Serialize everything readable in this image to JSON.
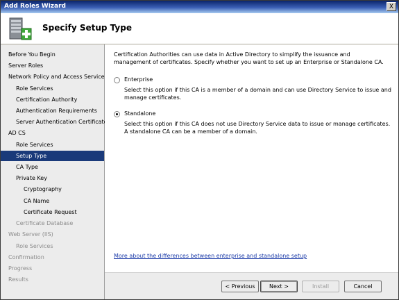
{
  "window": {
    "title": "Add Roles Wizard",
    "close_glyph": "X"
  },
  "header": {
    "title": "Specify Setup Type",
    "icon": "server-roles-add-icon"
  },
  "sidebar": {
    "items": [
      {
        "label": "Before You Begin",
        "level": 0,
        "state": "normal"
      },
      {
        "label": "Server Roles",
        "level": 0,
        "state": "normal"
      },
      {
        "label": "Network Policy and Access Services",
        "level": 0,
        "state": "normal"
      },
      {
        "label": "Role Services",
        "level": 1,
        "state": "normal"
      },
      {
        "label": "Certification Authority",
        "level": 1,
        "state": "normal"
      },
      {
        "label": "Authentication Requirements",
        "level": 1,
        "state": "normal"
      },
      {
        "label": "Server Authentication Certificate",
        "level": 1,
        "state": "normal"
      },
      {
        "label": "AD CS",
        "level": 0,
        "state": "normal"
      },
      {
        "label": "Role Services",
        "level": 1,
        "state": "normal"
      },
      {
        "label": "Setup Type",
        "level": 1,
        "state": "selected"
      },
      {
        "label": "CA Type",
        "level": 1,
        "state": "normal"
      },
      {
        "label": "Private Key",
        "level": 1,
        "state": "normal"
      },
      {
        "label": "Cryptography",
        "level": 2,
        "state": "normal"
      },
      {
        "label": "CA Name",
        "level": 2,
        "state": "normal"
      },
      {
        "label": "Certificate Request",
        "level": 2,
        "state": "normal"
      },
      {
        "label": "Certificate Database",
        "level": 1,
        "state": "disabled"
      },
      {
        "label": "Web Server (IIS)",
        "level": 0,
        "state": "disabled"
      },
      {
        "label": "Role Services",
        "level": 1,
        "state": "disabled"
      },
      {
        "label": "Confirmation",
        "level": 0,
        "state": "disabled"
      },
      {
        "label": "Progress",
        "level": 0,
        "state": "disabled"
      },
      {
        "label": "Results",
        "level": 0,
        "state": "disabled"
      }
    ]
  },
  "main": {
    "description": "Certification Authorities can use data in Active Directory to simplify the issuance and management of certificates. Specify whether you want to set up an Enterprise or Standalone CA.",
    "options": [
      {
        "label": "Enterprise",
        "selected": false,
        "description": "Select this option if this CA is a member of a domain and can use Directory Service to issue and manage certificates."
      },
      {
        "label": "Standalone",
        "selected": true,
        "description": "Select this option if this CA does not use Directory Service data to issue or manage certificates. A standalone CA can be a member of a domain."
      }
    ],
    "help_link": "More about the differences between enterprise and standalone setup"
  },
  "buttons": {
    "previous": "< Previous",
    "next": "Next >",
    "install": "Install",
    "cancel": "Cancel"
  }
}
